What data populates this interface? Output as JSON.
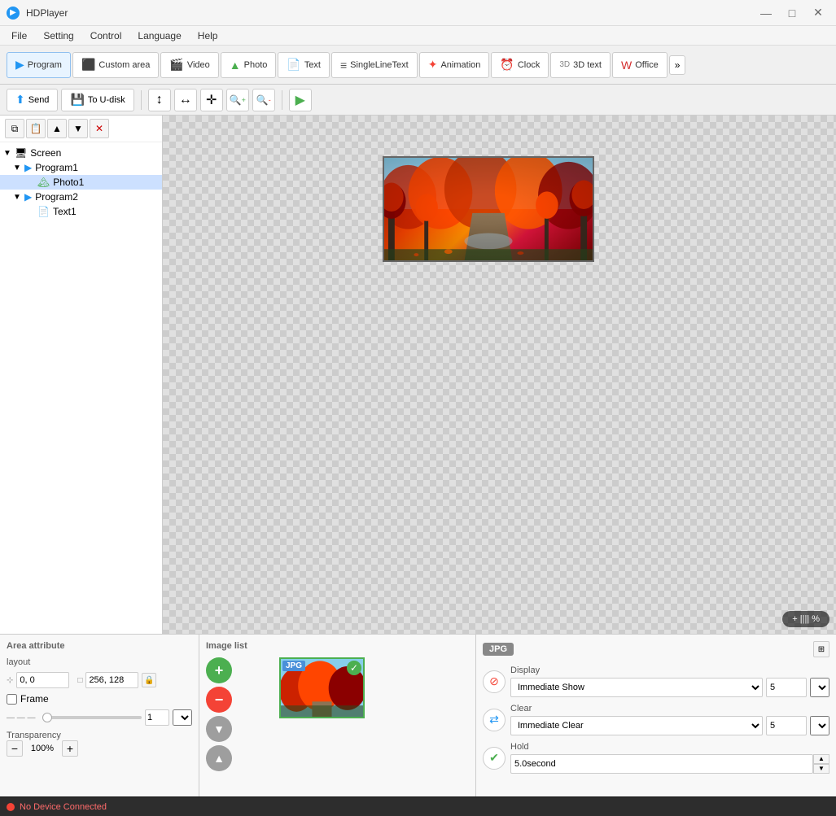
{
  "app": {
    "title": "HDPlayer",
    "icon": "🎬"
  },
  "titlebar": {
    "minimize": "—",
    "maximize": "□",
    "close": "✕"
  },
  "menubar": {
    "items": [
      "File",
      "Setting",
      "Control",
      "Language",
      "Help"
    ]
  },
  "toolbar": {
    "tabs": [
      {
        "id": "program",
        "label": "Program",
        "icon": "▶",
        "active": true
      },
      {
        "id": "custom-area",
        "label": "Custom area",
        "icon": "⬜"
      },
      {
        "id": "video",
        "label": "Video",
        "icon": "🎬"
      },
      {
        "id": "photo",
        "label": "Photo",
        "icon": "🏔"
      },
      {
        "id": "text",
        "label": "Text",
        "icon": "T"
      },
      {
        "id": "single-line-text",
        "label": "SingleLineText",
        "icon": "≡"
      },
      {
        "id": "animation",
        "label": "Animation",
        "icon": "✦"
      },
      {
        "id": "clock",
        "label": "Clock",
        "icon": "⏰"
      },
      {
        "id": "3d-text",
        "label": "3D text",
        "icon": "3D"
      },
      {
        "id": "office",
        "label": "Office",
        "icon": "W"
      },
      {
        "id": "more",
        "label": "»"
      }
    ]
  },
  "action_toolbar": {
    "send_label": "Send",
    "to_udisk_label": "To U-disk",
    "zoom_in_icon": "🔍",
    "zoom_out_icon": "🔎",
    "play_icon": "▶"
  },
  "tree": {
    "items": [
      {
        "id": "screen",
        "label": "Screen",
        "level": 0,
        "expanded": true,
        "icon": "🖥"
      },
      {
        "id": "program1",
        "label": "Program1",
        "level": 1,
        "expanded": true,
        "icon": "▶"
      },
      {
        "id": "photo1",
        "label": "Photo1",
        "level": 2,
        "expanded": false,
        "icon": "🏔",
        "selected": true
      },
      {
        "id": "program2",
        "label": "Program2",
        "level": 1,
        "expanded": true,
        "icon": "▶"
      },
      {
        "id": "text1",
        "label": "Text1",
        "level": 2,
        "expanded": false,
        "icon": "📄"
      }
    ]
  },
  "sidebar_tools": {
    "copy": "⧉",
    "paste": "📋",
    "up": "▲",
    "down": "▼",
    "delete": "✕"
  },
  "canvas": {
    "zoom_label": "+ ||||  %"
  },
  "bottom_panels": {
    "area_attr": {
      "title": "Area attribute",
      "layout_label": "layout",
      "x": "0, 0",
      "size": "256, 128",
      "frame_label": "Frame",
      "frame_value": "1",
      "transparency_label": "Transparency",
      "transparency_value": "100%"
    },
    "image_list": {
      "title": "Image list"
    },
    "jpg_panel": {
      "title": "JPG",
      "display_label": "Display",
      "display_value": "Immediate Show",
      "display_num": "5",
      "clear_label": "Clear",
      "clear_value": "Immediate Clear",
      "clear_num": "5",
      "hold_label": "Hold",
      "hold_value": "5.0second"
    }
  },
  "statusbar": {
    "text": "No Device Connected"
  }
}
